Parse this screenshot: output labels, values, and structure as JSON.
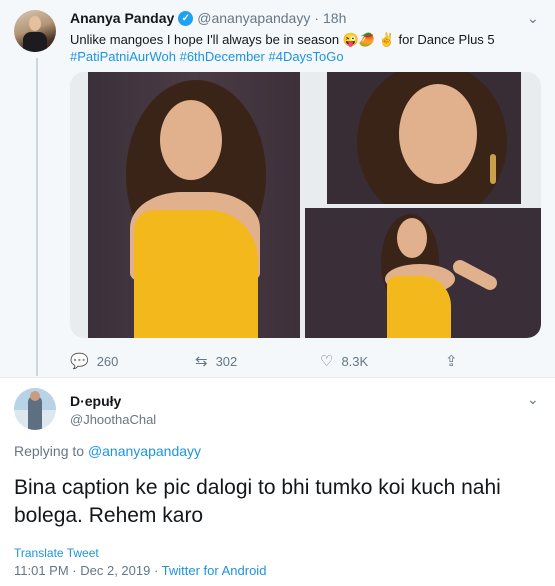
{
  "tweet1": {
    "name": "Ananya Panday",
    "verified_mark": "✓",
    "handle": "@ananyapandayy",
    "separator": "·",
    "time": "18h",
    "text_a": "Unlike mangoes I hope I'll always be in season ",
    "emojis": "😜🥭 ✌",
    "text_b": "for Dance Plus 5",
    "hashtags": "#PatiPatniAurWoh #6thDecember #4DaysToGo",
    "actions": {
      "reply_count": "260",
      "retweet_count": "302",
      "like_count": "8.3K"
    }
  },
  "tweet2": {
    "name": "D·epuły",
    "handle": "@JhoothaChal",
    "replying_label": "Replying to ",
    "replying_to": "@ananyapandayy",
    "text": "Bina caption ke pic dalogi to bhi tumko koi kuch nahi bolega. Rehem karo",
    "translate": "Translate Tweet",
    "timestamp": "11:01 PM · Dec 2, 2019 · ",
    "source": "Twitter for Android"
  },
  "icons": {
    "chevron": "⌄",
    "reply": "💬",
    "retweet": "⇆",
    "like": "♡",
    "share": "⇪"
  },
  "colors": {
    "link": "#1b95e0",
    "verified": "#1da1f2",
    "muted": "#657786"
  }
}
